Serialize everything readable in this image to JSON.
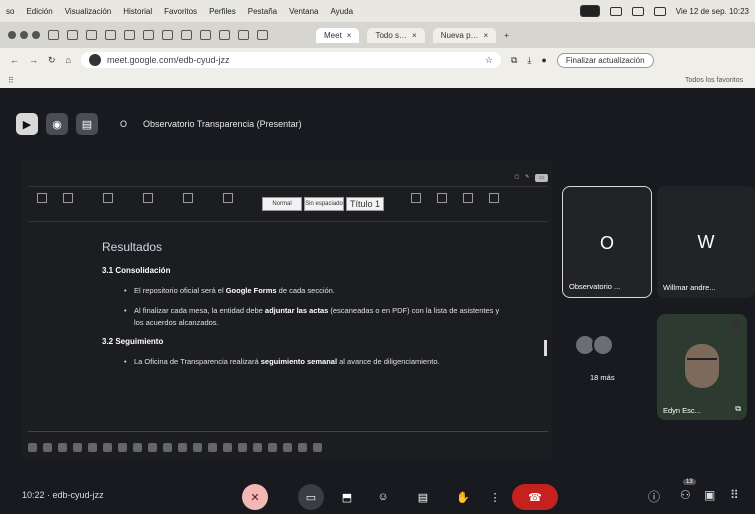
{
  "menubar": {
    "app_partial": "so",
    "items": [
      "Edición",
      "Visualización",
      "Historial",
      "Favoritos",
      "Perfiles",
      "Pestaña",
      "Ventana",
      "Ayuda"
    ],
    "datetime": "Vie 12 de sep. 10:23"
  },
  "tabs": {
    "meet_tab": "Meet",
    "tab2": "Todo s…",
    "tab3": "Nueva p…"
  },
  "address": {
    "url": "meet.google.com/edb-cyud-jzz",
    "update_button": "Finalizar actualización",
    "bookmarks_label": "Todos los favoritos"
  },
  "meet": {
    "present_title": "Observatorio Transparencia (Presentar)",
    "present_dot": "O",
    "meeting_time": "10:22",
    "meeting_code": "edb-cyud-jzz",
    "participants_count": "13"
  },
  "doc": {
    "ribbon_styles": [
      "Normal",
      "Sin espaciado",
      "Título 1"
    ],
    "heading": "Resultados",
    "section_1": "3.1 Consolidación",
    "s1_bullet1_a": "El repositorio oficial será el ",
    "s1_bullet1_b": "Google Forms",
    "s1_bullet1_c": " de cada sección.",
    "s1_bullet2_a": "Al finalizar cada mesa, la entidad debe ",
    "s1_bullet2_b": "adjuntar las actas",
    "s1_bullet2_c": " (escaneadas o en PDF) con la lista de asistentes y los acuerdos alcanzados.",
    "section_2": "3.2 Seguimiento",
    "s2_bullet1_a": "La Oficina de Transparencia realizará ",
    "s2_bullet1_b": "seguimiento semanal",
    "s2_bullet1_c": " al avance de diligenciamiento."
  },
  "participants": [
    {
      "letter": "O",
      "name": "Observatorio ..."
    },
    {
      "letter": "W",
      "name": "Willmar andre..."
    },
    {
      "letter": "",
      "name": "18 más"
    },
    {
      "letter": "",
      "name": "Edyn Esc..."
    }
  ]
}
